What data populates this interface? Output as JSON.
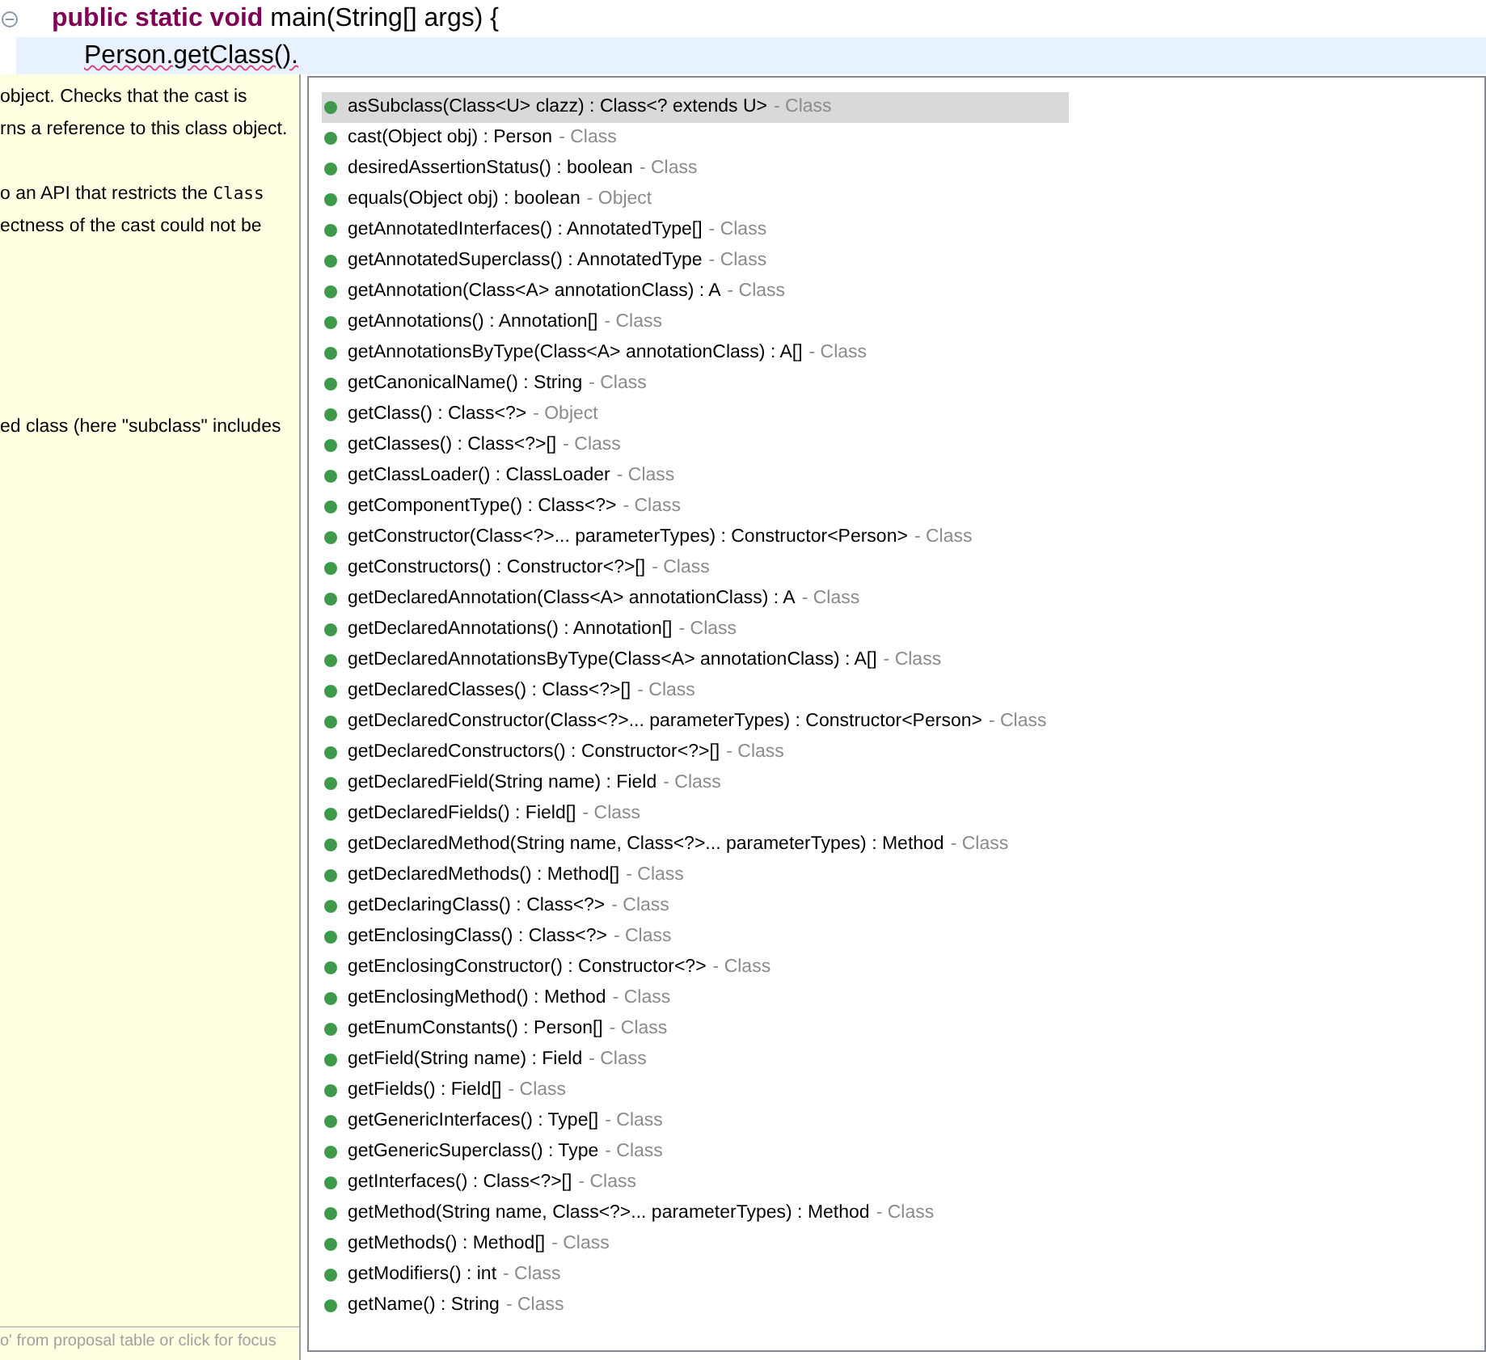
{
  "editor": {
    "lines": [
      {
        "parts": [
          {
            "text": "public static void",
            "keyword": true
          },
          {
            "text": " main(String[] args) {",
            "keyword": false
          }
        ],
        "current": false,
        "folding": true
      },
      {
        "parts": [
          {
            "text": "Person.getClass().",
            "keyword": false
          }
        ],
        "current": true,
        "folding": false,
        "error": true
      }
    ]
  },
  "javadoc": {
    "paragraphs": [
      [
        [
          {
            "text": "object. Checks that the cast is",
            "code": false
          }
        ],
        [
          {
            "text": "rns a reference to this class object.",
            "code": false
          }
        ]
      ],
      [
        [
          {
            "text": "o an API that restricts the ",
            "code": false
          },
          {
            "text": "Class",
            "code": true
          }
        ],
        [
          {
            "text": "ectness of the cast could not be",
            "code": false
          }
        ]
      ],
      [
        [
          {
            "text": "ed class (here \"subclass\" includes",
            "code": false
          }
        ]
      ]
    ],
    "status": "o' from proposal table or click for focus"
  },
  "proposals": [
    {
      "signature": "asSubclass(Class<U> clazz) : Class<? extends U>",
      "owner": "- Class",
      "selected": true
    },
    {
      "signature": "cast(Object obj) : Person",
      "owner": "- Class",
      "selected": false
    },
    {
      "signature": "desiredAssertionStatus() : boolean",
      "owner": "- Class",
      "selected": false
    },
    {
      "signature": "equals(Object obj) : boolean",
      "owner": "- Object",
      "selected": false
    },
    {
      "signature": "getAnnotatedInterfaces() : AnnotatedType[]",
      "owner": "- Class",
      "selected": false
    },
    {
      "signature": "getAnnotatedSuperclass() : AnnotatedType",
      "owner": "- Class",
      "selected": false
    },
    {
      "signature": "getAnnotation(Class<A> annotationClass) : A",
      "owner": "- Class",
      "selected": false
    },
    {
      "signature": "getAnnotations() : Annotation[]",
      "owner": "- Class",
      "selected": false
    },
    {
      "signature": "getAnnotationsByType(Class<A> annotationClass) : A[]",
      "owner": "- Class",
      "selected": false
    },
    {
      "signature": "getCanonicalName() : String",
      "owner": "- Class",
      "selected": false
    },
    {
      "signature": "getClass() : Class<?>",
      "owner": "- Object",
      "selected": false
    },
    {
      "signature": "getClasses() : Class<?>[]",
      "owner": "- Class",
      "selected": false
    },
    {
      "signature": "getClassLoader() : ClassLoader",
      "owner": "- Class",
      "selected": false
    },
    {
      "signature": "getComponentType() : Class<?>",
      "owner": "- Class",
      "selected": false
    },
    {
      "signature": "getConstructor(Class<?>... parameterTypes) : Constructor<Person>",
      "owner": "- Class",
      "selected": false
    },
    {
      "signature": "getConstructors() : Constructor<?>[]",
      "owner": "- Class",
      "selected": false
    },
    {
      "signature": "getDeclaredAnnotation(Class<A> annotationClass) : A",
      "owner": "- Class",
      "selected": false
    },
    {
      "signature": "getDeclaredAnnotations() : Annotation[]",
      "owner": "- Class",
      "selected": false
    },
    {
      "signature": "getDeclaredAnnotationsByType(Class<A> annotationClass) : A[]",
      "owner": "- Class",
      "selected": false
    },
    {
      "signature": "getDeclaredClasses() : Class<?>[]",
      "owner": "- Class",
      "selected": false
    },
    {
      "signature": "getDeclaredConstructor(Class<?>... parameterTypes) : Constructor<Person>",
      "owner": "- Class",
      "selected": false
    },
    {
      "signature": "getDeclaredConstructors() : Constructor<?>[]",
      "owner": "- Class",
      "selected": false
    },
    {
      "signature": "getDeclaredField(String name) : Field",
      "owner": "- Class",
      "selected": false
    },
    {
      "signature": "getDeclaredFields() : Field[]",
      "owner": "- Class",
      "selected": false
    },
    {
      "signature": "getDeclaredMethod(String name, Class<?>... parameterTypes) : Method",
      "owner": "- Class",
      "selected": false
    },
    {
      "signature": "getDeclaredMethods() : Method[]",
      "owner": "- Class",
      "selected": false
    },
    {
      "signature": "getDeclaringClass() : Class<?>",
      "owner": "- Class",
      "selected": false
    },
    {
      "signature": "getEnclosingClass() : Class<?>",
      "owner": "- Class",
      "selected": false
    },
    {
      "signature": "getEnclosingConstructor() : Constructor<?>",
      "owner": "- Class",
      "selected": false
    },
    {
      "signature": "getEnclosingMethod() : Method",
      "owner": "- Class",
      "selected": false
    },
    {
      "signature": "getEnumConstants() : Person[]",
      "owner": "- Class",
      "selected": false
    },
    {
      "signature": "getField(String name) : Field",
      "owner": "- Class",
      "selected": false
    },
    {
      "signature": "getFields() : Field[]",
      "owner": "- Class",
      "selected": false
    },
    {
      "signature": "getGenericInterfaces() : Type[]",
      "owner": "- Class",
      "selected": false
    },
    {
      "signature": "getGenericSuperclass() : Type",
      "owner": "- Class",
      "selected": false
    },
    {
      "signature": "getInterfaces() : Class<?>[]",
      "owner": "- Class",
      "selected": false
    },
    {
      "signature": "getMethod(String name, Class<?>... parameterTypes) : Method",
      "owner": "- Class",
      "selected": false
    },
    {
      "signature": "getMethods() : Method[]",
      "owner": "- Class",
      "selected": false
    },
    {
      "signature": "getModifiers() : int",
      "owner": "- Class",
      "selected": false
    },
    {
      "signature": "getName() : String",
      "owner": "- Class",
      "selected": false
    }
  ]
}
